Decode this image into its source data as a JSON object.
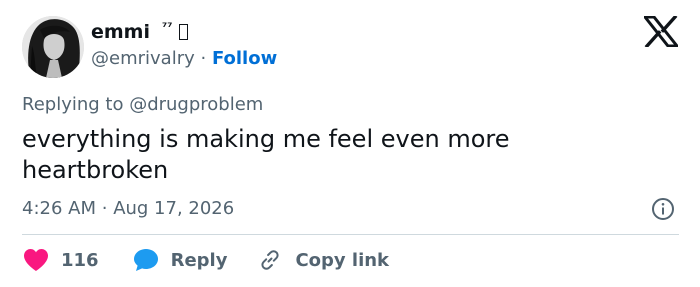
{
  "author": {
    "display_name": "emmi",
    "name_suffix": "⁷⁷",
    "handle": "@emrivalry",
    "separator": "·",
    "follow_label": "Follow"
  },
  "replying_to": "Replying to @drugproblem",
  "tweet": {
    "text": "everything is making me feel even more heartbroken",
    "time": "4:26 AM",
    "time_separator": "·",
    "date": "Aug 17, 2026"
  },
  "actions": {
    "like_count": "116",
    "reply_label": "Reply",
    "copy_label": "Copy link"
  },
  "icons": {
    "platform": "x-logo-icon",
    "info": "info-icon",
    "like": "heart-icon",
    "reply": "speech-bubble-icon",
    "copy": "link-icon"
  },
  "colors": {
    "like": "#f91880",
    "reply": "#1d9bf0",
    "follow": "#006fd6",
    "secondary_text": "#536471",
    "primary_text": "#0f1419"
  }
}
